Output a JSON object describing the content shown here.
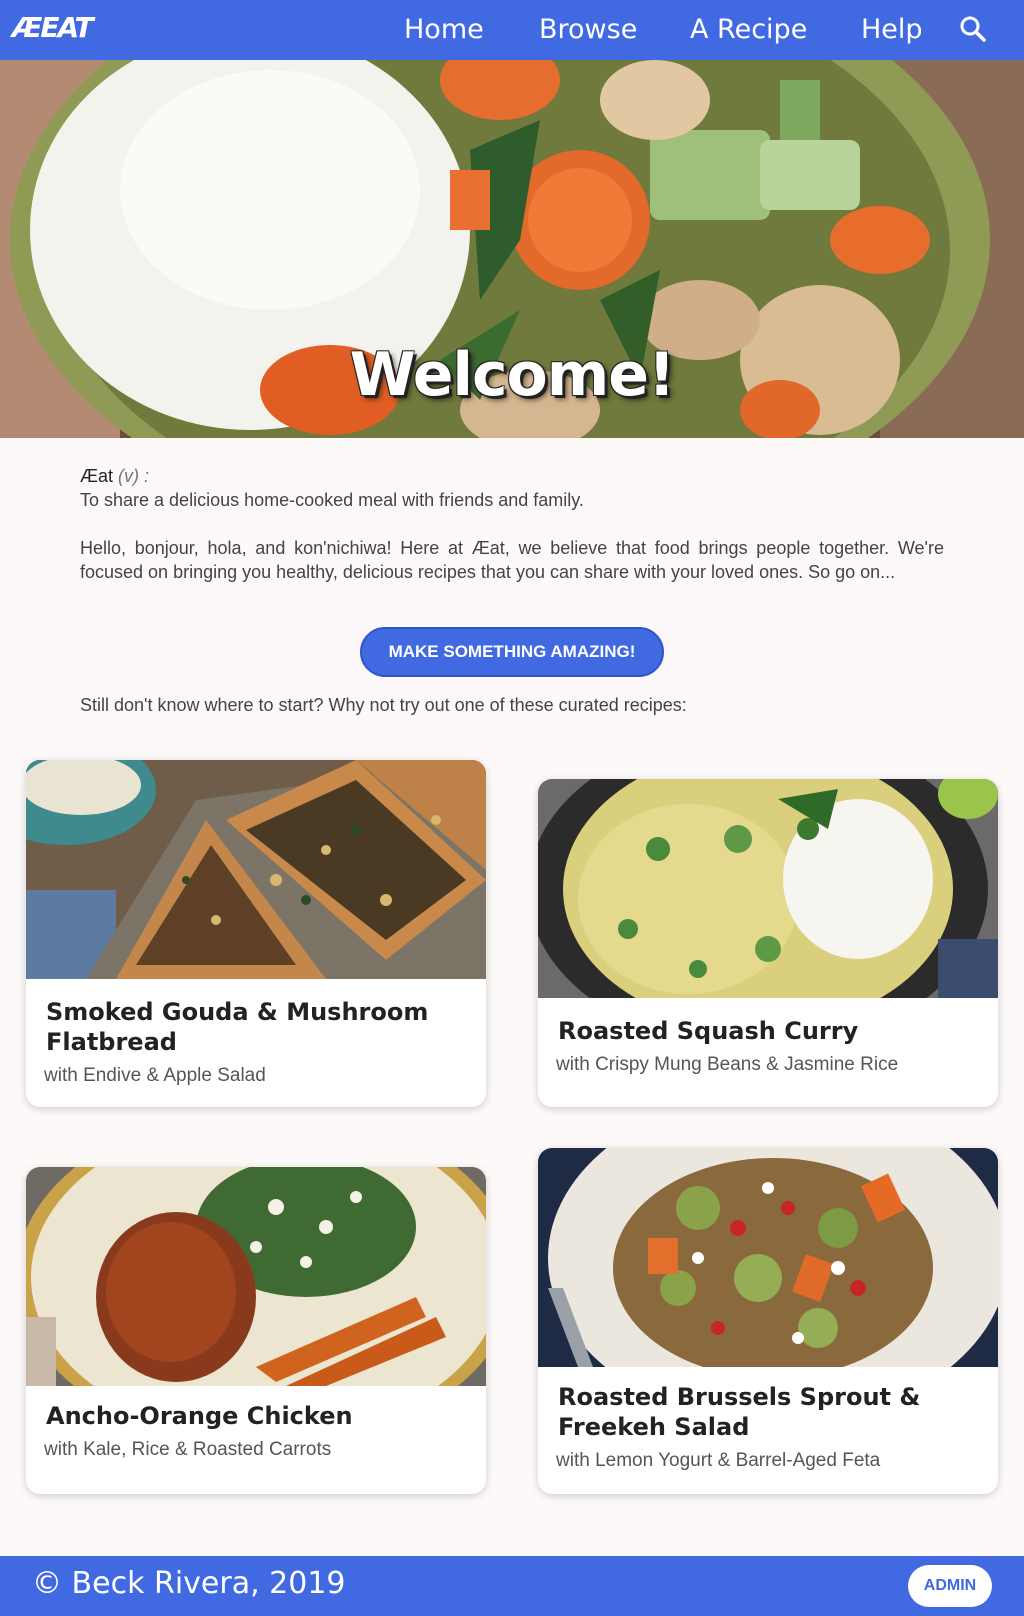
{
  "nav": {
    "logo": "ÆEAT",
    "links": [
      "Home",
      "Browse",
      "A Recipe",
      "Help"
    ],
    "search_icon": "search-icon"
  },
  "hero": {
    "title": "Welcome!",
    "image": "bowl of rice with chicken, carrots and bok choy stir-fry"
  },
  "intro": {
    "term": "Æat",
    "pos": "(v) :",
    "definition": "To share a delicious home-cooked meal with friends and family.",
    "paragraph": "Hello, bonjour, hola, and kon'nichiwa! Here at Æat, we believe that food brings people together. We're focused on bringing you healthy, delicious recipes that you can share with your loved ones. So go on...",
    "cta_label": "MAKE SOMETHING AMAZING!",
    "curated_text": "Still don't know where to start? Why not try out one of these curated recipes:"
  },
  "recipes": [
    {
      "title": "Smoked Gouda & Mushroom Flatbread",
      "subtitle": "with Endive & Apple Salad"
    },
    {
      "title": "Roasted Squash Curry",
      "subtitle": "with Crispy Mung Beans & Jasmine Rice"
    },
    {
      "title": "Ancho-Orange Chicken",
      "subtitle": "with Kale, Rice & Roasted Carrots"
    },
    {
      "title": "Roasted Brussels Sprout & Freekeh Salad",
      "subtitle": "with Lemon Yogurt & Barrel-Aged Feta"
    }
  ],
  "footer": {
    "copyright": "© Beck Rivera, 2019",
    "admin_label": "ADMIN"
  },
  "colors": {
    "brand": "#4169e1",
    "background": "#fcf9f8"
  }
}
